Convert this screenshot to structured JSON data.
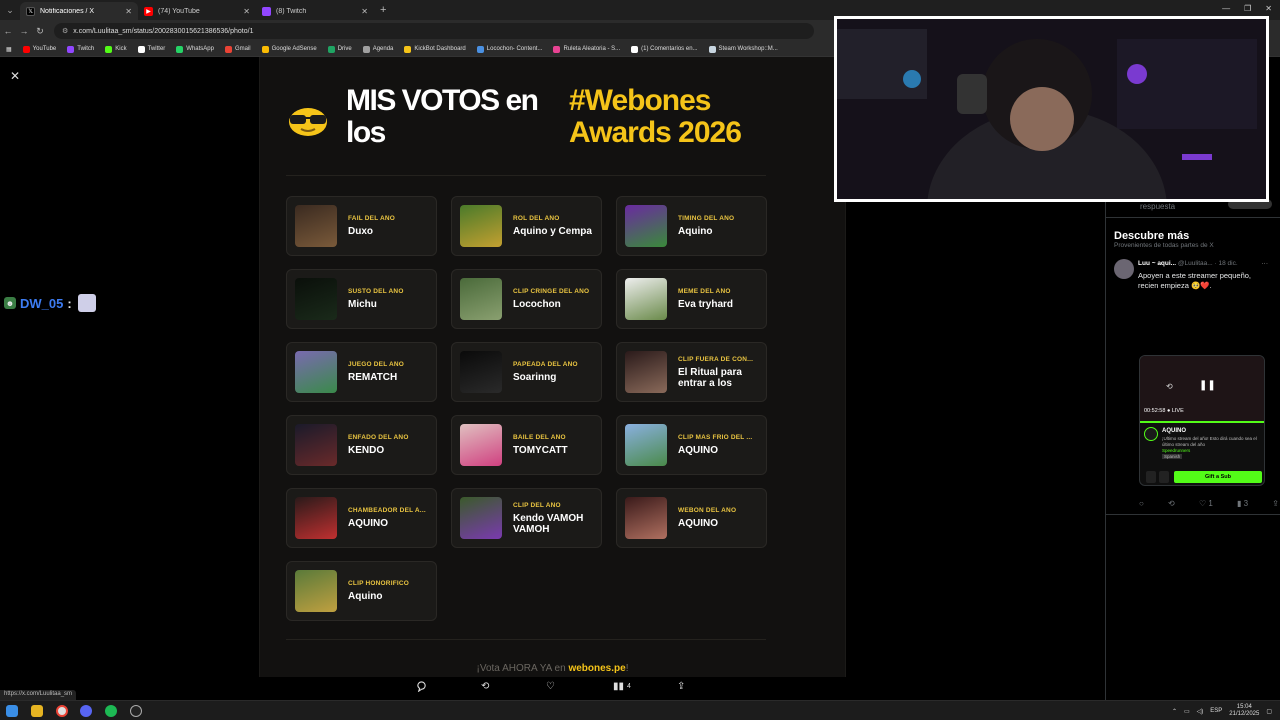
{
  "browser": {
    "tabs": [
      {
        "label": "Notificaciones / X",
        "icon": "x-icon",
        "color": "#000000"
      },
      {
        "label": "(74) YouTube",
        "icon": "youtube-icon",
        "color": "#ff0000"
      },
      {
        "label": "(8) Twitch",
        "icon": "twitch-icon",
        "color": "#9146ff"
      }
    ],
    "url": "x.com/Luulitaa_sm/status/2002830015621386536/photo/1",
    "bookmarks": [
      {
        "label": "YouTube",
        "color": "#ff0000"
      },
      {
        "label": "Twitch",
        "color": "#9146ff"
      },
      {
        "label": "Kick",
        "color": "#53fc18"
      },
      {
        "label": "Twitter",
        "color": "#ffffff"
      },
      {
        "label": "WhatsApp",
        "color": "#25d366"
      },
      {
        "label": "Gmail",
        "color": "#ea4335"
      },
      {
        "label": "Google AdSense",
        "color": "#fbbc04"
      },
      {
        "label": "Drive",
        "color": "#1fa463"
      },
      {
        "label": "Agenda",
        "color": "#a0a0a0"
      },
      {
        "label": "KickBot Dashboard",
        "color": "#f5c419"
      },
      {
        "label": "Locochon- Content...",
        "color": "#4a90e2"
      },
      {
        "label": "Ruleta Aleatoria - S...",
        "color": "#e84393"
      },
      {
        "label": "(1) Comentarios en...",
        "color": "#ffffff"
      },
      {
        "label": "Steam Workshop::M...",
        "color": "#c7d5e0"
      }
    ],
    "status_url": "https://x.com/Luulitaa_sm"
  },
  "chat": {
    "username": "DW_05",
    "separator": ":"
  },
  "post_image": {
    "title": "MIS VOTOS en los",
    "hashtag": "#Webones Awards 2026",
    "awards": [
      {
        "category": "FAIL DEL AÑO",
        "winner": "Duxo",
        "thumb": [
          "#3a2a20",
          "#7a5a3a"
        ]
      },
      {
        "category": "ROL DEL AÑO",
        "winner": "Aquino y Cempa",
        "thumb": [
          "#4a7a2a",
          "#c4a030"
        ]
      },
      {
        "category": "TIMING DEL AÑO",
        "winner": "Aquino",
        "thumb": [
          "#6a2aa0",
          "#3a8a3a"
        ]
      },
      {
        "category": "SUSTO DEL AÑO",
        "winner": "Michu",
        "thumb": [
          "#0a0f0a",
          "#1a2a1a"
        ]
      },
      {
        "category": "CLIP CRINGE DEL AÑO",
        "winner": "Locochon",
        "thumb": [
          "#4a6a3a",
          "#8aa070"
        ]
      },
      {
        "category": "MEME DEL AÑO",
        "winner": "Eva tryhard",
        "thumb": [
          "#eeeeee",
          "#6a8a4a"
        ]
      },
      {
        "category": "JUEGO DEL AÑO",
        "winner": "REMATCH",
        "thumb": [
          "#7a6ab0",
          "#3a8a4a"
        ]
      },
      {
        "category": "PAPEADA DEL AÑO",
        "winner": "Soarinng",
        "thumb": [
          "#0a0a0a",
          "#2a2a2a"
        ]
      },
      {
        "category": "CLIP FUERA DE CON...",
        "winner": "El Ritual para entrar a los",
        "thumb": [
          "#2a1a1a",
          "#8a6a5a"
        ]
      },
      {
        "category": "ENFADO DEL AÑO",
        "winner": "KENDO",
        "thumb": [
          "#1a1a2a",
          "#6a2a2a"
        ]
      },
      {
        "category": "BAILE DEL AÑO",
        "winner": "TOMYCATT",
        "thumb": [
          "#e0c0c0",
          "#d04080"
        ]
      },
      {
        "category": "CLIP MAS FRIO DEL ...",
        "winner": "AQUINO",
        "thumb": [
          "#8ab0e0",
          "#4a8a4a"
        ]
      },
      {
        "category": "CHAMBEADOR DEL A...",
        "winner": "AQUINO",
        "thumb": [
          "#2a1a1a",
          "#c03030"
        ]
      },
      {
        "category": "CLIP DEL AÑO",
        "winner": "Kendo VAMOH VAMOH",
        "thumb": [
          "#3a5a2a",
          "#7a3ab0"
        ]
      },
      {
        "category": "WEBON DEL AÑO",
        "winner": "AQUINO",
        "thumb": [
          "#3a1a1a",
          "#b07060"
        ]
      },
      {
        "category": "CLIP HONORIFICO",
        "winner": "Aquino",
        "thumb": [
          "#5a7a3a",
          "#c0a040"
        ]
      }
    ],
    "footer_text": "¡Vota AHORA YA en ",
    "footer_link": "webones.pe",
    "footer_end": "!"
  },
  "post_actions": {
    "views": "4"
  },
  "sidebar": {
    "reply_hint": "respuesta",
    "discover_title": "Descubre más",
    "discover_sub": "Provenientes de todas partes de X",
    "tweet": {
      "author": "Luu ~ aqui...",
      "handle": "@Luulitaa... · 18 dic.",
      "text": "Apoyen a este streamer pequeño, recien empieza 🥺❤️.",
      "media": {
        "time": "00:52:58",
        "live": "LIVE",
        "channel": "AQUINO",
        "stream_title": "¡Ultimo stream del año! Esto dirá cuando sea el último stream del año",
        "category": "Speedrunners",
        "language": "Spanish",
        "gift": "Gift a Sub"
      },
      "likes": "1",
      "views": "3"
    }
  },
  "taskbar": {
    "lang": "ESP",
    "time": "15:04",
    "date": "21/12/2025"
  }
}
